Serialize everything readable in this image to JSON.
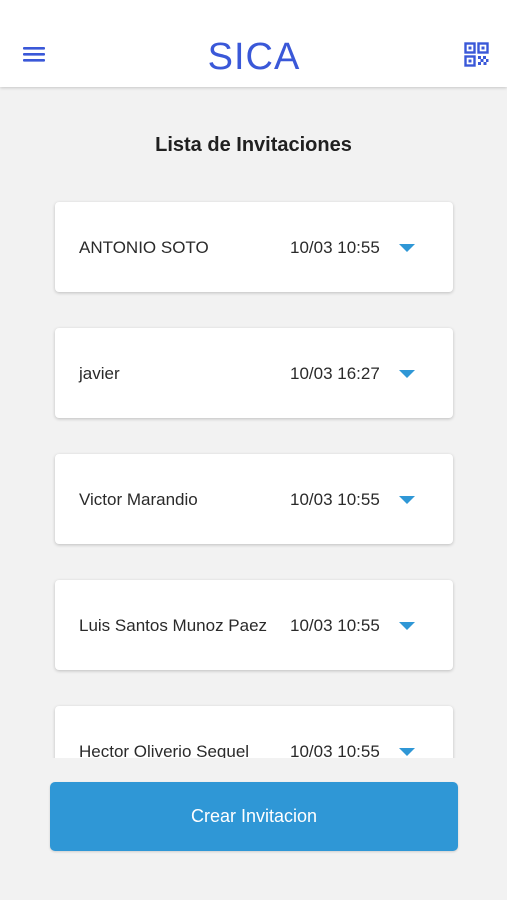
{
  "app": {
    "logo_text": "SICA",
    "brand_color": "#3a58d8",
    "accent_color": "#2f97d6"
  },
  "header": {
    "menu_icon": "hamburger-menu-icon",
    "qr_icon": "qr-code-icon"
  },
  "page": {
    "title": "Lista de Invitaciones"
  },
  "invitations": [
    {
      "name": "ANTONIO SOTO",
      "datetime": "10/03 10:55",
      "icon": "caret-down-icon"
    },
    {
      "name": "javier",
      "datetime": "10/03 16:27",
      "icon": "caret-down-icon"
    },
    {
      "name": "Victor Marandio",
      "datetime": "10/03 10:55",
      "icon": "caret-down-icon"
    },
    {
      "name": "Luis Santos Munoz Paez",
      "datetime": "10/03 10:55",
      "icon": "caret-down-icon"
    },
    {
      "name": "Hector Oliverio Sequel",
      "datetime": "10/03 10:55",
      "icon": "caret-down-icon"
    }
  ],
  "actions": {
    "create_label": "Crear Invitacion"
  }
}
